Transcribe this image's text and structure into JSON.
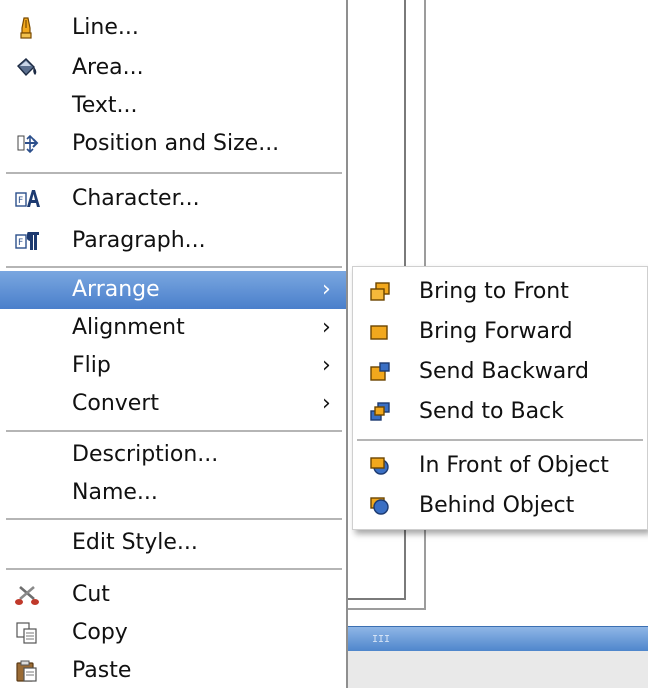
{
  "context_menu": {
    "items": [
      {
        "label": "Line...",
        "icon": "line-pen-icon"
      },
      {
        "label": "Area...",
        "icon": "paint-bucket-icon"
      },
      {
        "label": "Text...",
        "icon": ""
      },
      {
        "label": "Position and Size...",
        "icon": "position-size-icon"
      },
      {
        "label": "Character...",
        "icon": "character-icon"
      },
      {
        "label": "Paragraph...",
        "icon": "paragraph-icon"
      },
      {
        "label": "Arrange",
        "icon": "",
        "submenu": true
      },
      {
        "label": "Alignment",
        "icon": "",
        "submenu": true
      },
      {
        "label": "Flip",
        "icon": "",
        "submenu": true
      },
      {
        "label": "Convert",
        "icon": "",
        "submenu": true
      },
      {
        "label": "Description...",
        "icon": ""
      },
      {
        "label": "Name...",
        "icon": ""
      },
      {
        "label": "Edit Style...",
        "icon": ""
      },
      {
        "label": "Cut",
        "icon": "scissors-icon"
      },
      {
        "label": "Copy",
        "icon": "copy-icon"
      },
      {
        "label": "Paste",
        "icon": "paste-icon"
      }
    ],
    "submenu_arrow": "›",
    "active_item": "Arrange"
  },
  "arrange_submenu": {
    "items": [
      {
        "label": "Bring to Front",
        "icon": "bring-to-front-icon"
      },
      {
        "label": "Bring Forward",
        "icon": "bring-forward-icon"
      },
      {
        "label": "Send Backward",
        "icon": "send-backward-icon"
      },
      {
        "label": "Send to Back",
        "icon": "send-to-back-icon"
      },
      {
        "label": "In Front of Object",
        "icon": "in-front-of-object-icon"
      },
      {
        "label": "Behind Object",
        "icon": "behind-object-icon"
      }
    ]
  },
  "scrollbar": {
    "grip": "III"
  },
  "colors": {
    "highlight": "#4a7fcb",
    "icon_orange": "#f2a81d",
    "icon_blue": "#3a6fc4"
  }
}
